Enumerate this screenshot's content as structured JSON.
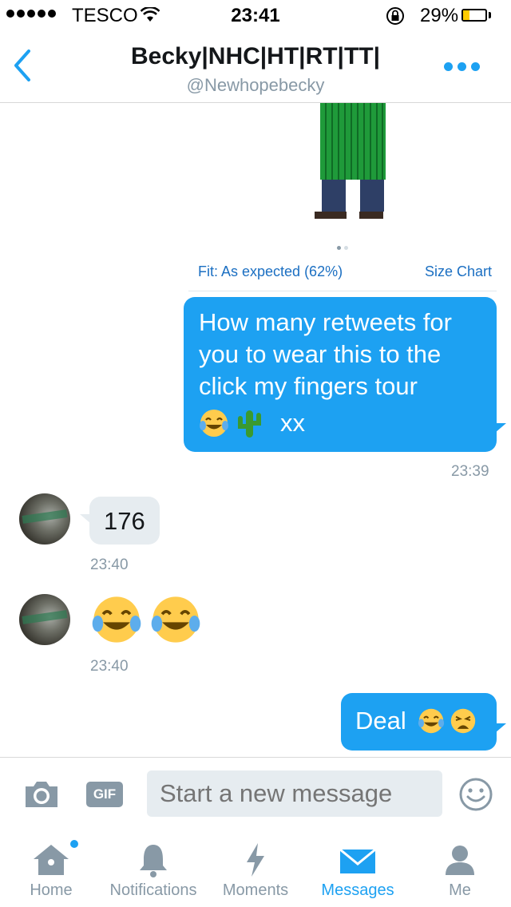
{
  "status_bar": {
    "carrier": "TESCO",
    "time": "23:41",
    "battery_percent": "29%",
    "battery_level": 0.29,
    "battery_color": "#ffcc00"
  },
  "header": {
    "title": "Becky|NHC|HT|RT|TT|",
    "handle": "@Newhopebecky",
    "back_icon": "chevron-left-icon",
    "more_icon": "more-dots-icon",
    "accent_color": "#1da1f2"
  },
  "product_card": {
    "fit_label": "Fit: As expected (62%)",
    "size_chart_link": "Size Chart",
    "carousel_pages": 2,
    "carousel_current": 1
  },
  "messages": [
    {
      "direction": "sent",
      "text": "How many retweets for you to wear this to the click my fingers tour",
      "emoji": [
        "joy",
        "cactus"
      ],
      "suffix": "xx",
      "timestamp": "23:39"
    },
    {
      "direction": "received",
      "text": "176",
      "timestamp": "23:40"
    },
    {
      "direction": "received",
      "emoji": [
        "joy",
        "joy"
      ],
      "timestamp": "23:40"
    },
    {
      "direction": "sent",
      "text": "Deal",
      "emoji": [
        "joy",
        "weary"
      ]
    }
  ],
  "composer": {
    "placeholder": "Start a new message",
    "camera_icon": "camera-icon",
    "gif_label": "GIF",
    "emoji_icon": "smiley-icon"
  },
  "tab_bar": {
    "tabs": [
      {
        "label": "Home",
        "icon": "home-icon",
        "active": false,
        "has_dot": true
      },
      {
        "label": "Notifications",
        "icon": "bell-icon",
        "active": false
      },
      {
        "label": "Moments",
        "icon": "lightning-icon",
        "active": false
      },
      {
        "label": "Messages",
        "icon": "envelope-icon",
        "active": true
      },
      {
        "label": "Me",
        "icon": "person-icon",
        "active": false
      }
    ],
    "inactive_color": "#8899a6",
    "active_color": "#1da1f2"
  }
}
